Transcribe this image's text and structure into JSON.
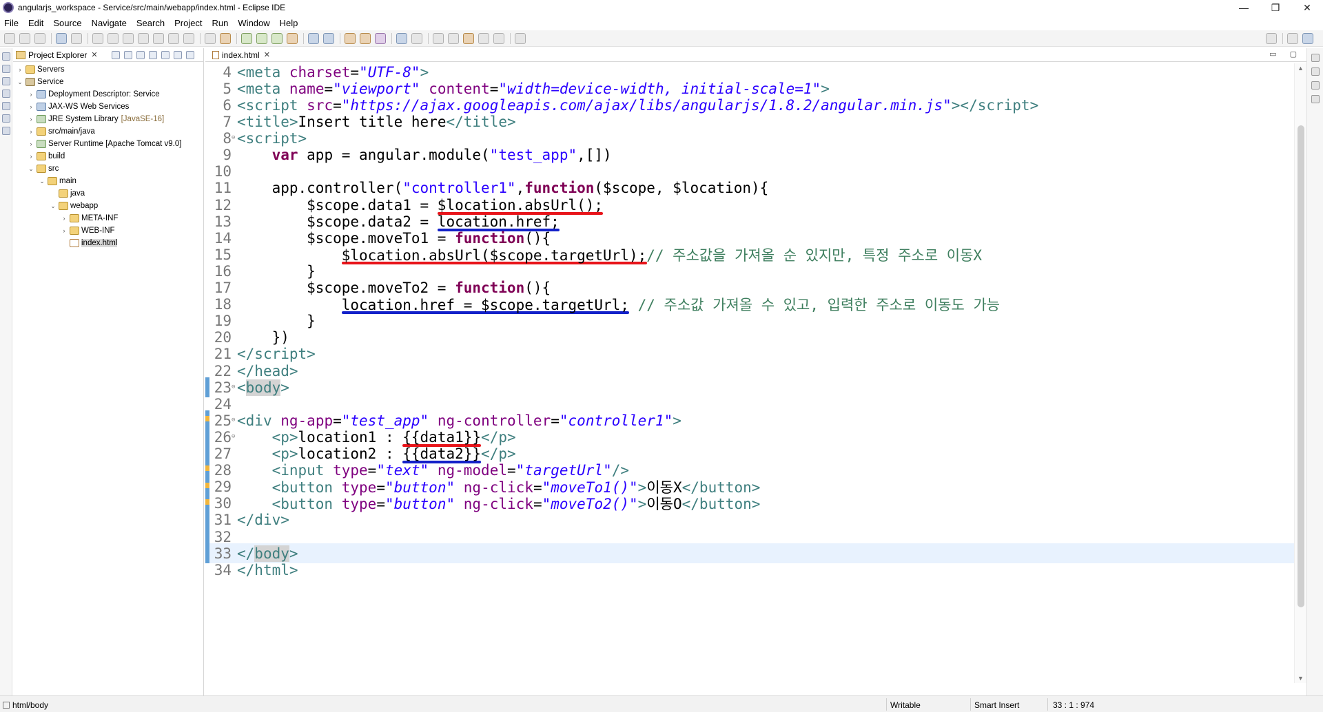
{
  "window": {
    "title": "angularjs_workspace - Service/src/main/webapp/index.html - Eclipse IDE",
    "controls": [
      "—",
      "❐",
      "✕"
    ]
  },
  "menu": [
    "File",
    "Edit",
    "Source",
    "Navigate",
    "Search",
    "Project",
    "Run",
    "Window",
    "Help"
  ],
  "explorer": {
    "tab_label": "Project Explorer",
    "close": "✕",
    "tree": [
      {
        "label": "Servers",
        "depth": 0,
        "twisty": "›",
        "icon": "folder"
      },
      {
        "label": "Service",
        "depth": 0,
        "twisty": "⌄",
        "icon": "proj"
      },
      {
        "label": "Deployment Descriptor: Service",
        "depth": 1,
        "twisty": "›",
        "icon": "srv"
      },
      {
        "label": "JAX-WS Web Services",
        "depth": 1,
        "twisty": "›",
        "icon": "srv"
      },
      {
        "label": "JRE System Library",
        "sub": "[JavaSE-16]",
        "depth": 1,
        "twisty": "›",
        "icon": "lib"
      },
      {
        "label": "src/main/java",
        "depth": 1,
        "twisty": "›",
        "icon": "folder"
      },
      {
        "label": "Server Runtime [Apache Tomcat v9.0]",
        "depth": 1,
        "twisty": "›",
        "icon": "lib"
      },
      {
        "label": "build",
        "depth": 1,
        "twisty": "›",
        "icon": "folder"
      },
      {
        "label": "src",
        "depth": 1,
        "twisty": "⌄",
        "icon": "folder"
      },
      {
        "label": "main",
        "depth": 2,
        "twisty": "⌄",
        "icon": "folder"
      },
      {
        "label": "java",
        "depth": 3,
        "twisty": "",
        "icon": "folder"
      },
      {
        "label": "webapp",
        "depth": 3,
        "twisty": "⌄",
        "icon": "folder"
      },
      {
        "label": "META-INF",
        "depth": 4,
        "twisty": "›",
        "icon": "folder"
      },
      {
        "label": "WEB-INF",
        "depth": 4,
        "twisty": "›",
        "icon": "folder"
      },
      {
        "label": "index.html",
        "depth": 4,
        "twisty": "",
        "icon": "file",
        "selected": true
      }
    ]
  },
  "editor": {
    "tab_label": "index.html",
    "close": "✕",
    "minmax": "▭ ▢",
    "line_numbers": [
      "4",
      "5",
      "6",
      "7",
      "8",
      "9",
      "10",
      "11",
      "12",
      "13",
      "14",
      "15",
      "16",
      "17",
      "18",
      "19",
      "20",
      "21",
      "22",
      "23",
      "24",
      "25",
      "26",
      "27",
      "28",
      "29",
      "30",
      "31",
      "32",
      "33",
      "34"
    ],
    "code": {
      "l4": [
        "<",
        "meta",
        " ",
        "charset",
        "=",
        "\"UTF-8\"",
        ">"
      ],
      "l5": [
        "<",
        "meta",
        " ",
        "name",
        "=",
        "\"viewport\"",
        " ",
        "content",
        "=",
        "\"width=device-width, initial-scale=1\"",
        ">"
      ],
      "l6": [
        "<",
        "script",
        " ",
        "src",
        "=",
        "\"https://ajax.googleapis.com/ajax/libs/angularjs/1.8.2/angular.min.js\"",
        "></",
        "script",
        ">"
      ],
      "l7": [
        "<",
        "title",
        ">",
        "Insert title here",
        "</",
        "title",
        ">"
      ],
      "l8": [
        "<",
        "script",
        ">"
      ],
      "l9": [
        "    ",
        "var",
        " app = angular.module(",
        "\"test_app\"",
        ",[])"
      ],
      "l10": [
        ""
      ],
      "l11": [
        "    app.controller(",
        "\"controller1\"",
        ",",
        "function",
        "($scope, $location){"
      ],
      "l12": [
        "        $scope.data1 = ",
        "$location.absUrl();"
      ],
      "l13": [
        "        $scope.data2 = ",
        "location.href;"
      ],
      "l14": [
        "        $scope.moveTo1 = ",
        "function",
        "(){"
      ],
      "l15": [
        "            ",
        "$location.absUrl($scope.targetUrl);",
        "// 주소값을 가져올 순 있지만, 특정 주소로 이동X"
      ],
      "l16": [
        "        }"
      ],
      "l17": [
        "        $scope.moveTo2 = ",
        "function",
        "(){"
      ],
      "l18": [
        "            ",
        "location.href = $scope.targetUrl;",
        " ",
        "// 주소값 가져올 수 있고, 입력한 주소로 이동도 가능"
      ],
      "l19": [
        "        }"
      ],
      "l20": [
        "    })"
      ],
      "l21": [
        "</",
        "script",
        ">"
      ],
      "l22": [
        "</",
        "head",
        ">"
      ],
      "l23": [
        "<",
        "body",
        ">"
      ],
      "l24": [
        ""
      ],
      "l25": [
        "<",
        "div",
        " ",
        "ng-app",
        "=",
        "\"test_app\"",
        " ",
        "ng-controller",
        "=",
        "\"controller1\"",
        ">"
      ],
      "l26": [
        "    <",
        "p",
        ">",
        "location1 : ",
        "{{data1}}",
        "</",
        "p",
        ">"
      ],
      "l27": [
        "    <",
        "p",
        ">",
        "location2 : ",
        "{{data2}}",
        "</",
        "p",
        ">"
      ],
      "l28": [
        "    <",
        "input",
        " ",
        "type",
        "=",
        "\"text\"",
        " ",
        "ng-model",
        "=",
        "\"targetUrl\"",
        "/>"
      ],
      "l29": [
        "    <",
        "button",
        " ",
        "type",
        "=",
        "\"button\"",
        " ",
        "ng-click",
        "=",
        "\"moveTo1()\"",
        ">",
        "이동X",
        "</",
        "button",
        ">"
      ],
      "l30": [
        "    <",
        "button",
        " ",
        "type",
        "=",
        "\"button\"",
        " ",
        "ng-click",
        "=",
        "\"moveTo2()\"",
        ">",
        "이동O",
        "</",
        "button",
        ">"
      ],
      "l31": [
        "</",
        "div",
        ">"
      ],
      "l32": [
        ""
      ],
      "l33": [
        "</",
        "body",
        ">"
      ],
      "l34": [
        "</",
        "html",
        ">"
      ]
    },
    "annotation_colors": {
      "red": "#e8141a",
      "blue": "#1321c9"
    }
  },
  "statusbar": {
    "path": "html/body",
    "writable": "Writable",
    "insert_mode": "Smart Insert",
    "position": "33 : 1 : 974"
  }
}
